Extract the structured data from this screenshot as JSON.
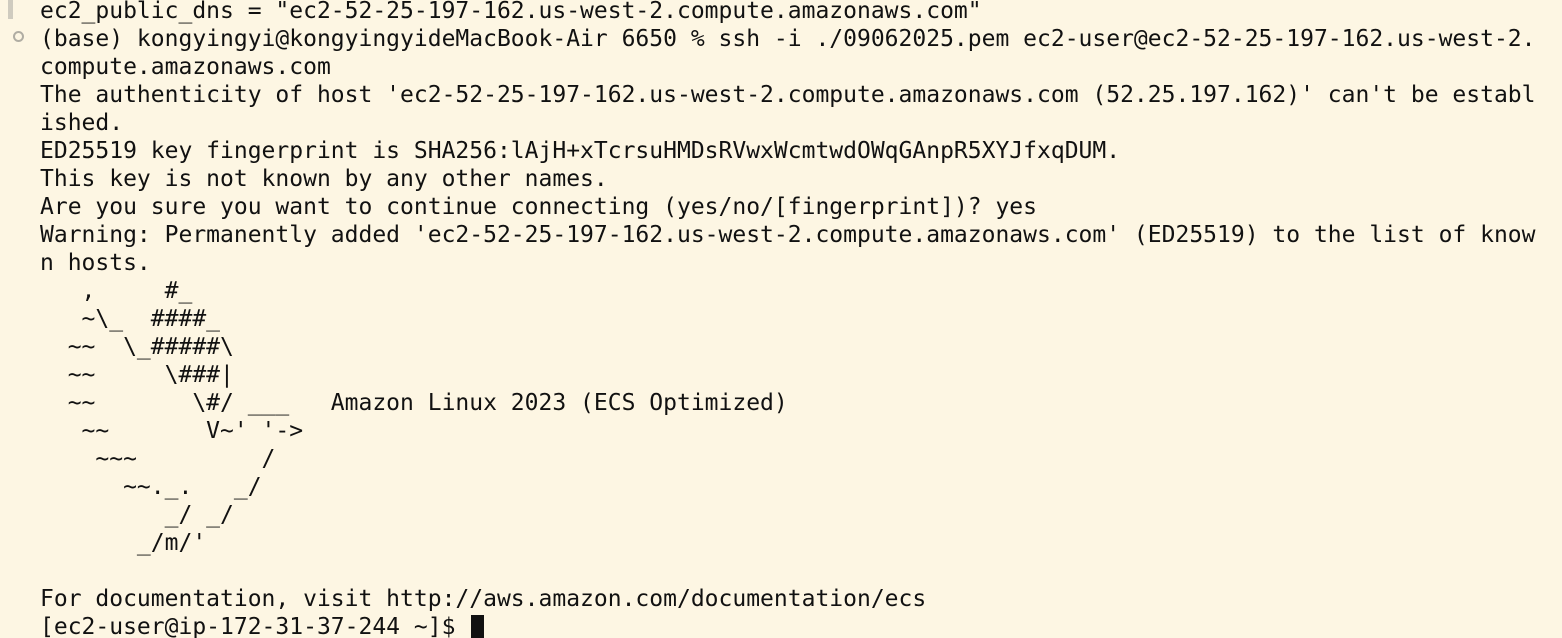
{
  "terminal": {
    "lines": [
      "ec2_public_dns = \"ec2-52-25-197-162.us-west-2.compute.amazonaws.com\"",
      "(base) kongyingyi@kongyingyideMacBook-Air 6650 % ssh -i ./09062025.pem ec2-user@ec2-52-25-197-162.us-west-2.",
      "compute.amazonaws.com",
      "The authenticity of host 'ec2-52-25-197-162.us-west-2.compute.amazonaws.com (52.25.197.162)' can't be establ",
      "ished.",
      "ED25519 key fingerprint is SHA256:lAjH+xTcrsuHMDsRVwxWcmtwdOWqGAnpR5XYJfxqDUM.",
      "This key is not known by any other names.",
      "Are you sure you want to continue connecting (yes/no/[fingerprint])? yes",
      "Warning: Permanently added 'ec2-52-25-197-162.us-west-2.compute.amazonaws.com' (ED25519) to the list of know",
      "n hosts.",
      "   ,     #_",
      "   ~\\_  ####_",
      "  ~~  \\_#####\\",
      "  ~~     \\###|",
      "  ~~       \\#/ ___   Amazon Linux 2023 (ECS Optimized)",
      "   ~~       V~' '->",
      "    ~~~         /",
      "      ~~._.   _/",
      "         _/ _/",
      "       _/m/'",
      "",
      "For documentation, visit http://aws.amazon.com/documentation/ecs"
    ],
    "prompt": "[ec2-user@ip-172-31-37-244 ~]$ "
  }
}
